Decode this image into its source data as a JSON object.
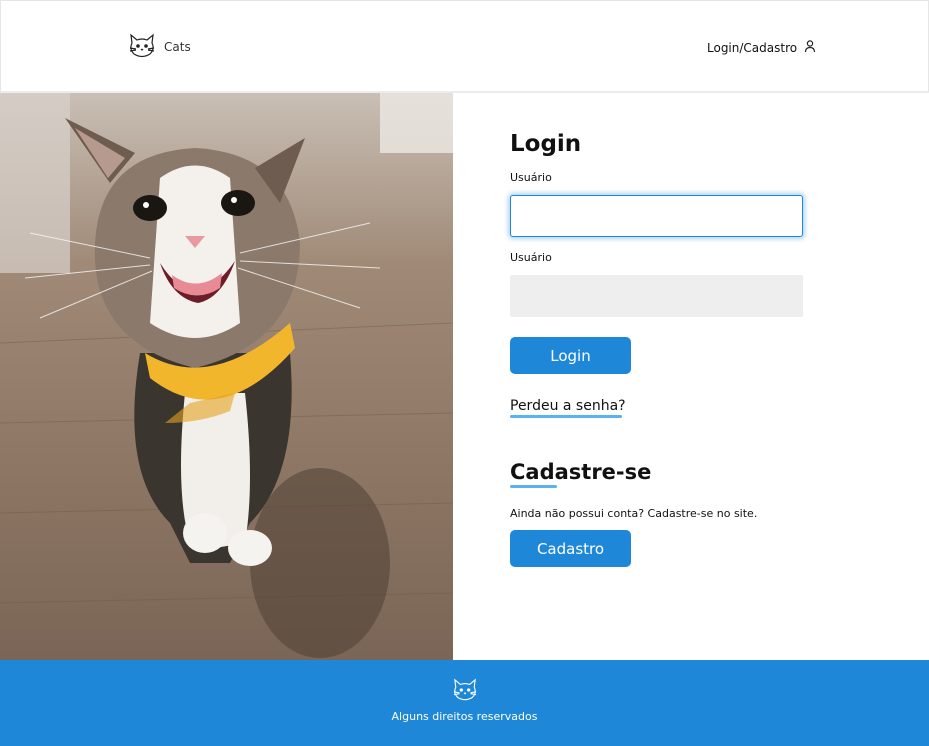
{
  "header": {
    "logo_text": "Cats",
    "logo_icon": "cat-face-icon",
    "user_link": "Login/Cadastro",
    "user_icon": "person-icon"
  },
  "hero_image": {
    "alt": "Gato sorrindo com bandana amarela"
  },
  "login": {
    "title": "Login",
    "field1_label": "Usuário",
    "field1_value": "",
    "field2_label": "Usuário",
    "field2_value": "",
    "button_label": "Login",
    "forgot_link": "Perdeu a senha?"
  },
  "register": {
    "title": "Cadastre-se",
    "text": "Ainda não possui conta? Cadastre-se no site.",
    "button_label": "Cadastro"
  },
  "footer": {
    "icon": "cat-face-icon",
    "text": "Alguns direitos reservados"
  },
  "colors": {
    "accent": "#1e87d8",
    "underline": "#5bb2ee",
    "input_bg": "#eeeeee"
  }
}
